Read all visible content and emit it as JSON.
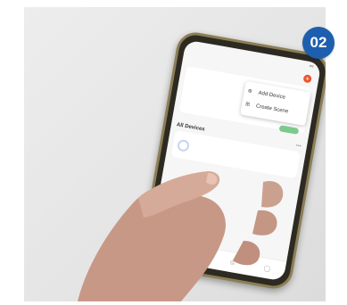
{
  "step_badge": "02",
  "phone": {
    "status_time": "",
    "home_name": "",
    "card_tag": "",
    "card_text": "",
    "menu": [
      {
        "icon": "add-icon",
        "glyph": "⊕",
        "label": "Add Device"
      },
      {
        "icon": "scan-icon",
        "glyph": "⊞",
        "label": "Create Scene"
      }
    ],
    "section_title": "All Devices",
    "section_more": "···",
    "device": {
      "name": "",
      "status": ""
    },
    "nav": [
      {
        "icon": "home-icon",
        "glyph": "⌂",
        "label": "",
        "active": true
      },
      {
        "icon": "smart-icon",
        "glyph": "▢",
        "label": "",
        "active": false
      },
      {
        "icon": "scene-icon",
        "glyph": "◎",
        "label": "",
        "active": false
      },
      {
        "icon": "profile-icon",
        "glyph": "◯",
        "label": "",
        "active": false
      }
    ]
  },
  "colors": {
    "badge": "#1d5fae",
    "accent": "#e8552f",
    "phone_frame": "#8c7e55"
  }
}
